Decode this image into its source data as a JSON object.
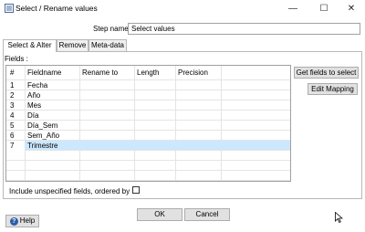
{
  "window": {
    "title": "Select / Rename values",
    "controls": {
      "minimize": "—",
      "maximize": "☐",
      "close": "✕"
    }
  },
  "step": {
    "label": "Step name",
    "value": "Select values"
  },
  "tabs": [
    {
      "label": "Select & Alter",
      "active": true
    },
    {
      "label": "Remove",
      "active": false
    },
    {
      "label": "Meta-data",
      "active": false
    }
  ],
  "fields_label": "Fields :",
  "grid": {
    "columns": [
      "#",
      "Fieldname",
      "Rename to",
      "Length",
      "Precision"
    ],
    "rows": [
      {
        "num": "1",
        "fieldname": "Fecha"
      },
      {
        "num": "2",
        "fieldname": "Año"
      },
      {
        "num": "3",
        "fieldname": "Mes"
      },
      {
        "num": "4",
        "fieldname": "Día"
      },
      {
        "num": "5",
        "fieldname": "Día_Sem"
      },
      {
        "num": "6",
        "fieldname": "Sem_Año"
      },
      {
        "num": "7",
        "fieldname": "Trimestre"
      }
    ],
    "selected_row": "7"
  },
  "side_buttons": {
    "get_fields": "Get fields to select",
    "edit_mapping": "Edit Mapping"
  },
  "include_label": "Include unspecified fields, ordered by",
  "buttons": {
    "ok": "OK",
    "cancel": "Cancel",
    "help": "Help"
  },
  "colors": {
    "selection": "#cce8ff",
    "help_accent": "#2a5ca8"
  }
}
